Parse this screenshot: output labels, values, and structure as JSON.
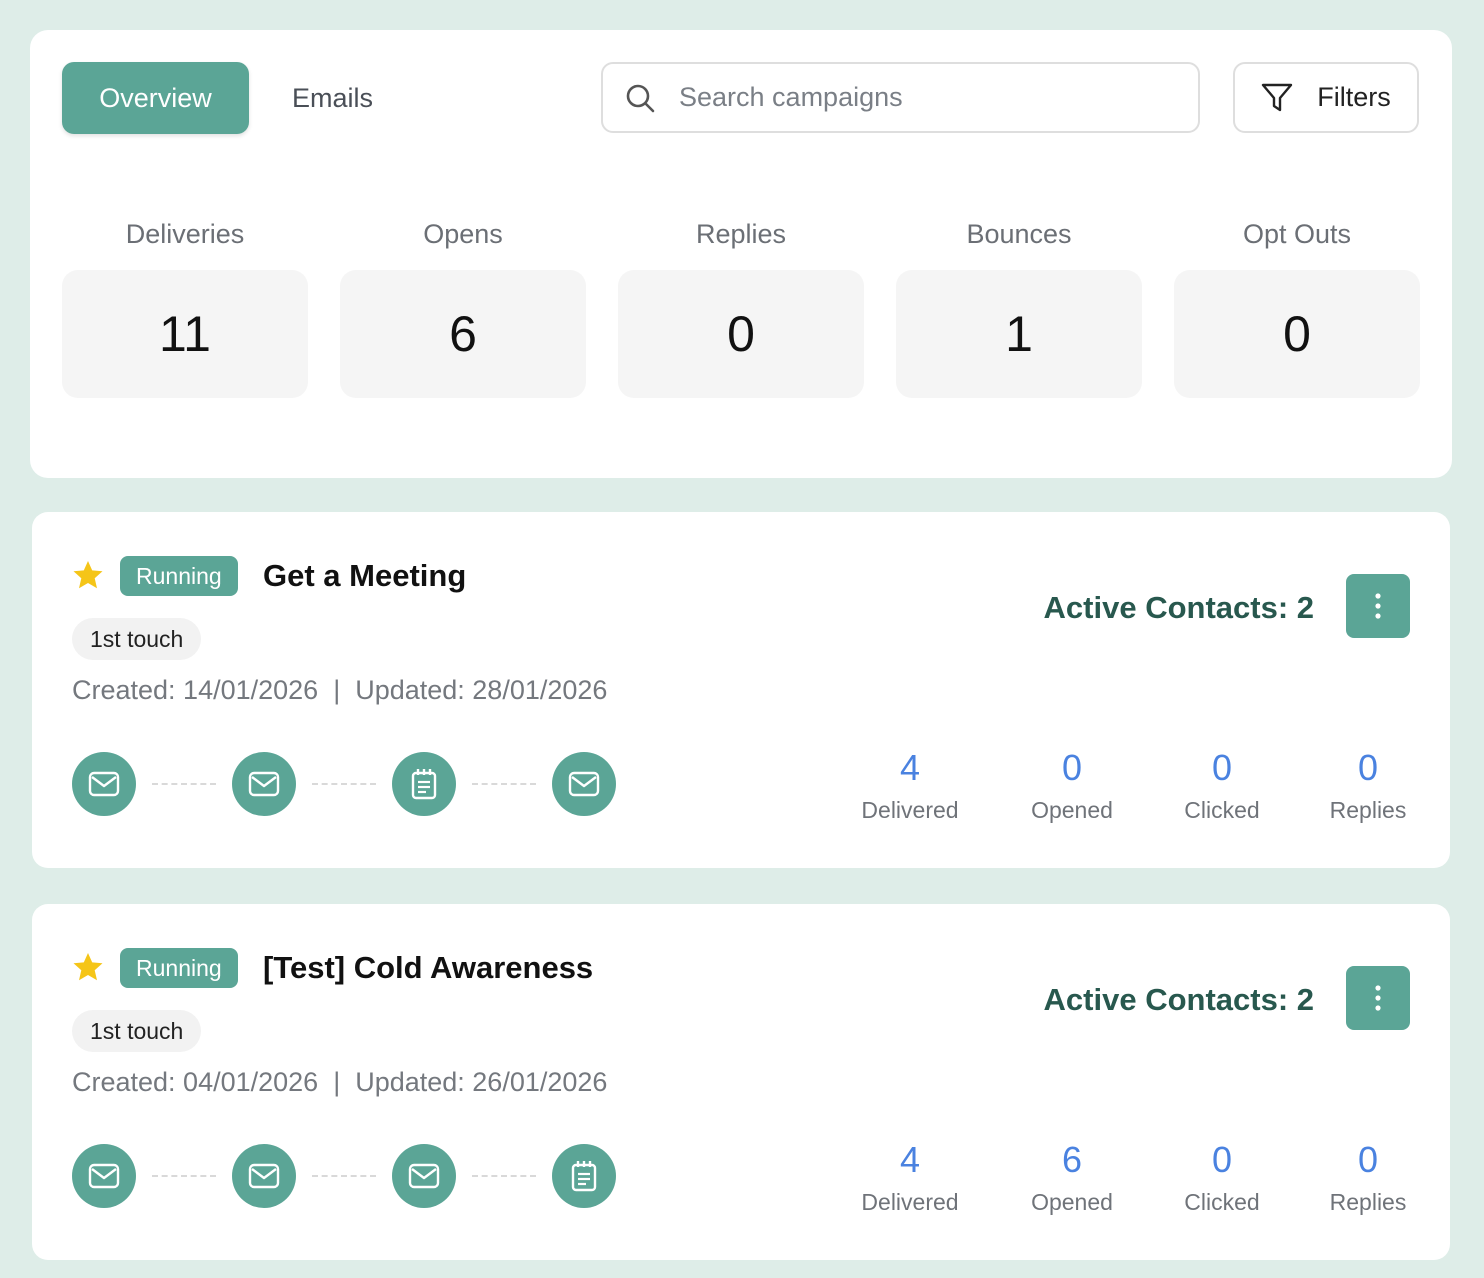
{
  "tabs": [
    {
      "label": "Overview",
      "active": true
    },
    {
      "label": "Emails",
      "active": false
    }
  ],
  "search": {
    "placeholder": "Search campaigns",
    "value": ""
  },
  "filters": {
    "label": "Filters"
  },
  "stats": [
    {
      "label": "Deliveries",
      "value": "11"
    },
    {
      "label": "Opens",
      "value": "6"
    },
    {
      "label": "Replies",
      "value": "0"
    },
    {
      "label": "Bounces",
      "value": "1"
    },
    {
      "label": "Opt Outs",
      "value": "0"
    }
  ],
  "colors": {
    "accent": "#5ba596",
    "background": "#deede8",
    "metric_value": "#4a82e0",
    "active_contacts": "#28584e",
    "star": "#f5c518"
  },
  "campaigns": [
    {
      "starred": true,
      "status": "Running",
      "title": "Get a Meeting",
      "tag": "1st touch",
      "dates": "Created: 14/01/2026  |  Updated: 28/01/2026",
      "active_contacts": "Active Contacts: 2",
      "steps": [
        "mail-icon",
        "mail-icon",
        "task-icon",
        "mail-icon"
      ],
      "metrics": [
        {
          "value": "4",
          "label": "Delivered"
        },
        {
          "value": "0",
          "label": "Opened"
        },
        {
          "value": "0",
          "label": "Clicked"
        },
        {
          "value": "0",
          "label": "Replies"
        }
      ]
    },
    {
      "starred": true,
      "status": "Running",
      "title": "[Test] Cold Awareness",
      "tag": "1st touch",
      "dates": "Created: 04/01/2026  |  Updated: 26/01/2026",
      "active_contacts": "Active Contacts: 2",
      "steps": [
        "mail-icon",
        "mail-icon",
        "mail-icon",
        "task-icon"
      ],
      "metrics": [
        {
          "value": "4",
          "label": "Delivered"
        },
        {
          "value": "6",
          "label": "Opened"
        },
        {
          "value": "0",
          "label": "Clicked"
        },
        {
          "value": "0",
          "label": "Replies"
        }
      ]
    }
  ]
}
